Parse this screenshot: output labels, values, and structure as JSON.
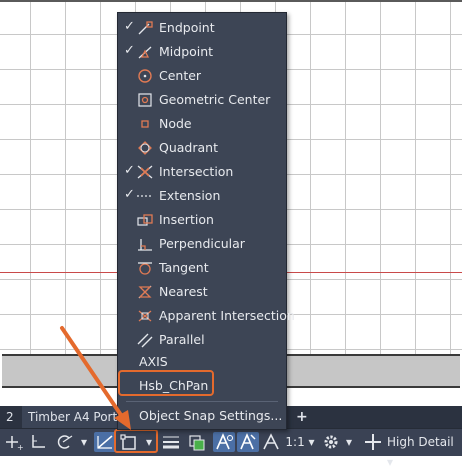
{
  "layout_tabs": {
    "number": "2",
    "timber": "Timber A4 Port",
    "add": "+"
  },
  "osnap_menu": {
    "items": [
      {
        "label": "Endpoint",
        "checked": true,
        "icon": "endpoint-icon"
      },
      {
        "label": "Midpoint",
        "checked": true,
        "icon": "midpoint-icon"
      },
      {
        "label": "Center",
        "checked": false,
        "icon": "center-icon"
      },
      {
        "label": "Geometric Center",
        "checked": false,
        "icon": "geometric-center-icon"
      },
      {
        "label": "Node",
        "checked": false,
        "icon": "node-icon"
      },
      {
        "label": "Quadrant",
        "checked": false,
        "icon": "quadrant-icon"
      },
      {
        "label": "Intersection",
        "checked": true,
        "icon": "intersection-icon"
      },
      {
        "label": "Extension",
        "checked": true,
        "icon": "extension-icon"
      },
      {
        "label": "Insertion",
        "checked": false,
        "icon": "insertion-icon"
      },
      {
        "label": "Perpendicular",
        "checked": false,
        "icon": "perpendicular-icon"
      },
      {
        "label": "Tangent",
        "checked": false,
        "icon": "tangent-icon"
      },
      {
        "label": "Nearest",
        "checked": false,
        "icon": "nearest-icon"
      },
      {
        "label": "Apparent Intersection",
        "checked": false,
        "icon": "apparent-intersection-icon"
      },
      {
        "label": "Parallel",
        "checked": false,
        "icon": "parallel-icon"
      }
    ],
    "axis": "AXIS",
    "hsb_chpan": "Hsb_ChPan",
    "settings": "Object Snap Settings...",
    "check_glyph": "✓"
  },
  "status_bar": {
    "scale": "1:1",
    "detail": "High Detail",
    "dropdown_arrow": "▾"
  },
  "colors": {
    "menu_bg": "#3d4555",
    "accent": "#e46a2d",
    "status_active": "#4b6fa5",
    "icon_stroke": "#e07a54"
  }
}
